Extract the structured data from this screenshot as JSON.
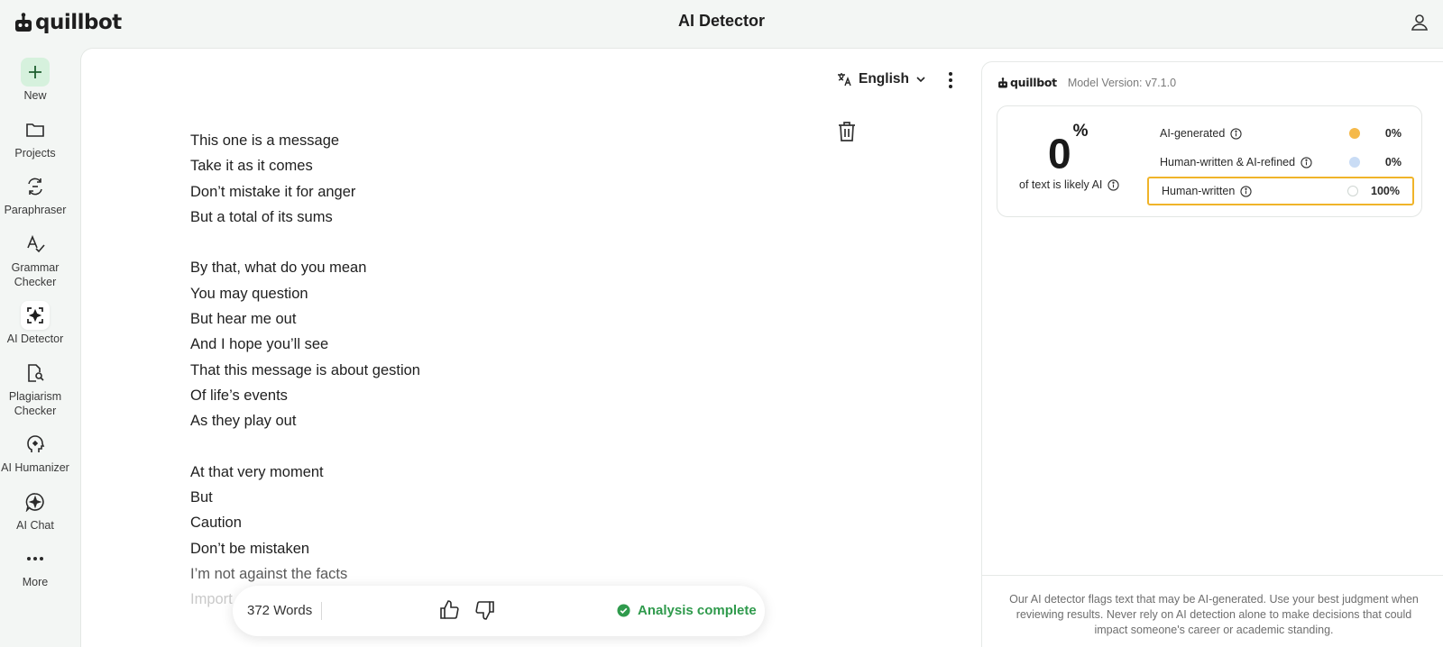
{
  "app": {
    "logo_text": "quillbot",
    "title": "AI Detector"
  },
  "sidebar": {
    "items": [
      {
        "label": "New",
        "icon": "plus-icon"
      },
      {
        "label": "Projects",
        "icon": "folder-icon"
      },
      {
        "label": "Paraphraser",
        "icon": "paraphrase-icon"
      },
      {
        "label": "Grammar\nChecker",
        "icon": "grammar-check-icon"
      },
      {
        "label": "AI Detector",
        "icon": "ai-detector-icon"
      },
      {
        "label": "Plagiarism\nChecker",
        "icon": "plagiarism-icon"
      },
      {
        "label": "AI Humanizer",
        "icon": "humanizer-icon"
      },
      {
        "label": "AI Chat",
        "icon": "chat-icon"
      },
      {
        "label": "More",
        "icon": "more-icon"
      }
    ]
  },
  "editor": {
    "language": "English",
    "lines": [
      "This one is a message",
      "Take it as it comes",
      "Don’t mistake it for anger",
      "But a total of its sums",
      "",
      "By that, what do you mean",
      "You may question",
      "But hear me out",
      "And I hope you’ll see",
      "That this message is about gestion",
      "Of life’s events",
      "As they play out",
      "",
      "At that very moment",
      "But",
      "Caution",
      "Don’t be mistaken",
      "I’m not against the facts",
      "Import"
    ],
    "word_count": "372 Words",
    "status": "Analysis complete"
  },
  "results": {
    "brand": "quillbot",
    "model_version": "Model Version: v7.1.0",
    "score_value": "0",
    "score_unit": "%",
    "score_caption": "of text is likely AI",
    "categories": [
      {
        "name": "AI-generated",
        "value": "0%",
        "color": "#f5b94a"
      },
      {
        "name": "Human-written & AI-refined",
        "value": "0%",
        "color": "#c9dcf5"
      },
      {
        "name": "Human-written",
        "value": "100%",
        "color": "#ffffff"
      }
    ],
    "highlight_color": "#f0b429",
    "disclaimer": "Our AI detector flags text that may be AI-generated. Use your best judgment when reviewing results. Never rely on AI detection alone to make decisions that could impact someone's career or academic standing."
  },
  "colors": {
    "accent_green": "#2f9a4c",
    "new_button_bg": "#d6f1dd"
  }
}
